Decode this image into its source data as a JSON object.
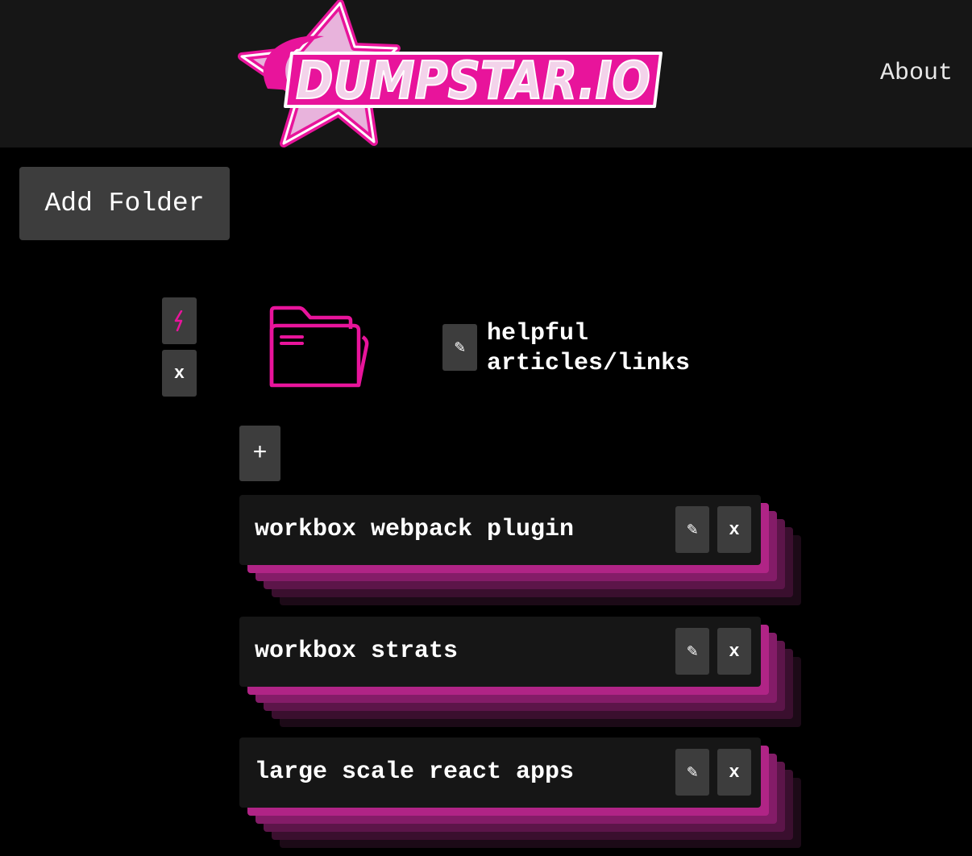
{
  "header": {
    "logo_text": "DUMPSTAR.IO",
    "about_label": "About"
  },
  "toolbar": {
    "add_folder_label": "Add Folder"
  },
  "folder": {
    "name": "helpful articles/links",
    "bolt_icon": "bolt-icon",
    "delete_label": "x",
    "edit_icon": "pencil-icon",
    "add_link_label": "+"
  },
  "links": [
    {
      "title": "workbox webpack plugin",
      "edit_icon": "pencil-icon",
      "delete_label": "x"
    },
    {
      "title": "workbox strats",
      "edit_icon": "pencil-icon",
      "delete_label": "x"
    },
    {
      "title": "large scale react apps",
      "edit_icon": "pencil-icon",
      "delete_label": "x"
    }
  ],
  "colors": {
    "accent": "#e8149b",
    "background": "#000000",
    "header": "#161616",
    "button": "#3d3d3d"
  }
}
